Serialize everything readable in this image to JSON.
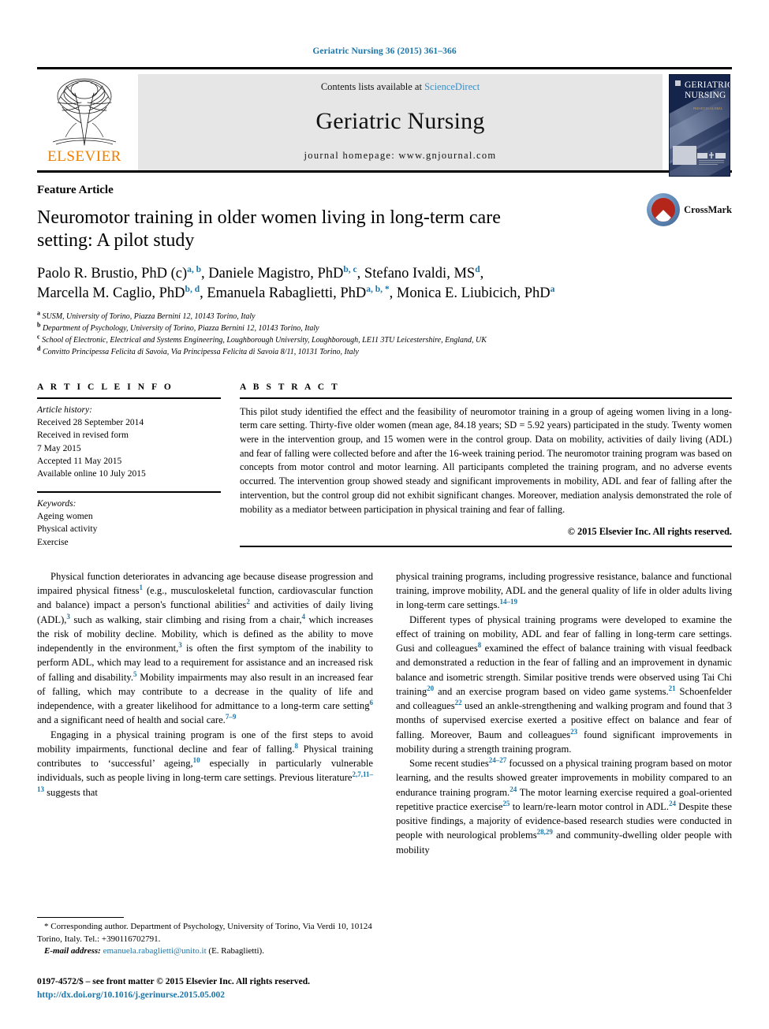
{
  "running_head": "Geriatric Nursing 36 (2015) 361–366",
  "masthead": {
    "publisher_name": "ELSEVIER",
    "contents_prefix": "Contents lists available at ",
    "sciencedirect": "ScienceDirect",
    "journal_name": "Geriatric Nursing",
    "homepage": "journal homepage: www.gnjournal.com",
    "cover_title_line1": "GERIATRIC",
    "cover_title_line2": "NURSING",
    "cover_subtitle": "PRESENTS GLOBAL"
  },
  "article": {
    "section_label": "Feature Article",
    "title": "Neuromotor training in older women living in long-term care setting: A pilot study",
    "crossmark_label": "CrossMark",
    "authors_line1": "Paolo R. Brustio, PhD (c)",
    "authors_line1_sup1": "a, b",
    "authors_line1_b": ", Daniele Magistro, PhD",
    "authors_line1_sup2": "b, c",
    "authors_line1_c": ", Stefano Ivaldi, MS",
    "authors_line1_sup3": "d",
    "authors_line1_d": ",",
    "authors_line2": "Marcella M. Caglio, PhD",
    "authors_line2_sup1": "b, d",
    "authors_line2_b": ", Emanuela Rabaglietti, PhD",
    "authors_line2_sup2": "a, b, *",
    "authors_line2_c": ", Monica E. Liubicich, PhD",
    "authors_line2_sup3": "a",
    "affiliations": [
      {
        "mark": "a",
        "text": "SUSM, University of Torino, Piazza Bernini 12, 10143 Torino, Italy"
      },
      {
        "mark": "b",
        "text": "Department of Psychology, University of Torino, Piazza Bernini 12, 10143 Torino, Italy"
      },
      {
        "mark": "c",
        "text": "School of Electronic, Electrical and Systems Engineering, Loughborough University, Loughborough, LE11 3TU Leicestershire, England, UK"
      },
      {
        "mark": "d",
        "text": "Convitto Principessa Felicita di Savoia, Via Principessa Felicita di Savoia 8/11, 10131 Torino, Italy"
      }
    ]
  },
  "article_info": {
    "heading": "A R T I C L E  I N F O",
    "history_label": "Article history:",
    "history": [
      "Received 28 September 2014",
      "Received in revised form",
      "7 May 2015",
      "Accepted 11 May 2015",
      "Available online 10 July 2015"
    ],
    "keywords_label": "Keywords:",
    "keywords": [
      "Ageing women",
      "Physical activity",
      "Exercise"
    ]
  },
  "abstract": {
    "heading": "A B S T R A C T",
    "text": "This pilot study identified the effect and the feasibility of neuromotor training in a group of ageing women living in a long-term care setting. Thirty-five older women (mean age, 84.18 years; SD = 5.92 years) participated in the study. Twenty women were in the intervention group, and 15 women were in the control group. Data on mobility, activities of daily living (ADL) and fear of falling were collected before and after the 16-week training period. The neuromotor training program was based on concepts from motor control and motor learning. All participants completed the training program, and no adverse events occurred. The intervention group showed steady and significant improvements in mobility, ADL and fear of falling after the intervention, but the control group did not exhibit significant changes. Moreover, mediation analysis demonstrated the role of mobility as a mediator between participation in physical training and fear of falling.",
    "copyright": "© 2015 Elsevier Inc. All rights reserved."
  },
  "body": {
    "left": [
      {
        "indent": true,
        "parts": [
          {
            "t": "Physical function deteriorates in advancing age because disease progression and impaired physical fitness"
          },
          {
            "s": "1"
          },
          {
            "t": " (e.g., musculoskeletal function, cardiovascular function and balance) impact a person's functional abilities"
          },
          {
            "s": "2"
          },
          {
            "t": " and activities of daily living (ADL),"
          },
          {
            "s": "3"
          },
          {
            "t": " such as walking, stair climbing and rising from a chair,"
          },
          {
            "s": "4"
          },
          {
            "t": " which increases the risk of mobility decline. Mobility, which is defined as the ability to move independently in the environment,"
          },
          {
            "s": "3"
          },
          {
            "t": " is often the first symptom of the inability to perform ADL, which may lead to a requirement for assistance and an increased risk of falling and disability."
          },
          {
            "s": "5"
          },
          {
            "t": " Mobility impairments may also result in an increased fear of falling, which may contribute to a decrease in the quality of life and independence, with a greater likelihood for admittance to a long-term care setting"
          },
          {
            "s": "6"
          },
          {
            "t": " and a significant need of health and social care."
          },
          {
            "s": "7–9"
          }
        ]
      },
      {
        "indent": true,
        "parts": [
          {
            "t": "Engaging in a physical training program is one of the first steps to avoid mobility impairments, functional decline and fear of falling."
          },
          {
            "s": "8"
          },
          {
            "t": " Physical training contributes to ‘successful’ ageing,"
          },
          {
            "s": "10"
          },
          {
            "t": " especially in particularly vulnerable individuals, such as people living in long-term care settings. Previous literature"
          },
          {
            "s": "2,7,11–13"
          },
          {
            "t": " suggests that"
          }
        ]
      }
    ],
    "right": [
      {
        "indent": false,
        "parts": [
          {
            "t": "physical training programs, including progressive resistance, balance and functional training, improve mobility, ADL and the general quality of life in older adults living in long-term care settings."
          },
          {
            "s": "14–19"
          }
        ]
      },
      {
        "indent": true,
        "parts": [
          {
            "t": "Different types of physical training programs were developed to examine the effect of training on mobility, ADL and fear of falling in long-term care settings. Gusi and colleagues"
          },
          {
            "s": "8"
          },
          {
            "t": " examined the effect of balance training with visual feedback and demonstrated a reduction in the fear of falling and an improvement in dynamic balance and isometric strength. Similar positive trends were observed using Tai Chi training"
          },
          {
            "s": "20"
          },
          {
            "t": " and an exercise program based on video game systems."
          },
          {
            "s": "21"
          },
          {
            "t": " Schoenfelder and colleagues"
          },
          {
            "s": "22"
          },
          {
            "t": " used an ankle-strengthening and walking program and found that 3 months of supervised exercise exerted a positive effect on balance and fear of falling. Moreover, Baum and colleagues"
          },
          {
            "s": "23"
          },
          {
            "t": " found significant improvements in mobility during a strength training program."
          }
        ]
      },
      {
        "indent": true,
        "parts": [
          {
            "t": "Some recent studies"
          },
          {
            "s": "24–27"
          },
          {
            "t": " focussed on a physical training program based on motor learning, and the results showed greater improvements in mobility compared to an endurance training program."
          },
          {
            "s": "24"
          },
          {
            "t": " The motor learning exercise required a goal-oriented repetitive practice exercise"
          },
          {
            "s": "25"
          },
          {
            "t": " to learn/re-learn motor control in ADL."
          },
          {
            "s": "24"
          },
          {
            "t": " Despite these positive findings, a majority of evidence-based research studies were conducted in people with neurological problems"
          },
          {
            "s": "28,29"
          },
          {
            "t": " and community-dwelling older people with mobility"
          }
        ]
      }
    ]
  },
  "footnote": {
    "corresponding": "* Corresponding author. Department of Psychology, University of Torino, Via Verdi 10, 10124 Torino, Italy. Tel.: +390116702791.",
    "email_label": "E-mail address:",
    "email": "emanuela.rabaglietti@unito.it",
    "email_suffix": " (E. Rabaglietti)."
  },
  "colophon": {
    "issn_line": "0197-4572/$ – see front matter © 2015 Elsevier Inc. All rights reserved.",
    "doi": "http://dx.doi.org/10.1016/j.gerinurse.2015.05.002"
  },
  "colors": {
    "link": "#1b75a8",
    "elsevier_orange": "#EE7F00",
    "band_gray": "#e6e6e6",
    "cover_navy": "#15244b"
  }
}
